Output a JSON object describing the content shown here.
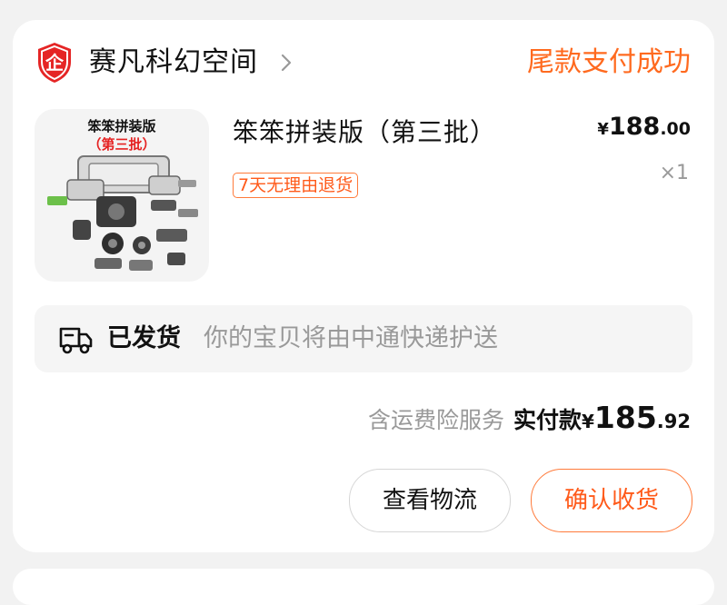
{
  "shop": {
    "logo_text": "企",
    "name": "赛凡科幻空间",
    "brand_color": "#e52525"
  },
  "order": {
    "status": "尾款支付成功",
    "accent_color": "#ff6a1f"
  },
  "product": {
    "thumbnail_line1": "笨笨拼装版",
    "thumbnail_line2": "（第三批）",
    "title": "笨笨拼装版（第三批）",
    "badge": "7天无理由退货",
    "price_currency": "¥",
    "price_integer": "188",
    "price_decimal": ".00",
    "quantity": "×1"
  },
  "logistics": {
    "status": "已发货",
    "note": "你的宝贝将由中通快递护送"
  },
  "payment": {
    "insurance_note": "含运费险服务",
    "paid_label": "实付款",
    "currency": "¥",
    "amount_integer": "185",
    "amount_decimal": ".92"
  },
  "actions": {
    "view_logistics": "查看物流",
    "confirm_receipt": "确认收货"
  }
}
